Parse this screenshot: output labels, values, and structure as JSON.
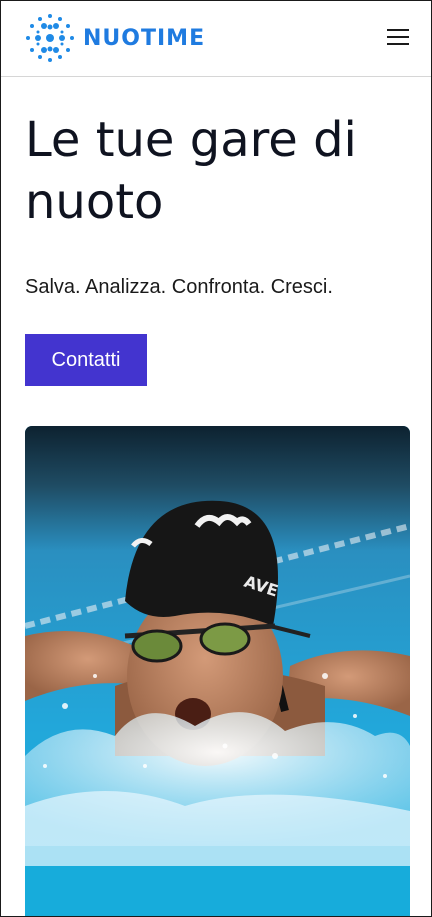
{
  "header": {
    "logo_text": "NUOTIME",
    "logo_icon": "dot-grid-logo-icon",
    "menu_icon": "hamburger-menu-icon",
    "brand_color": "#1f7be0"
  },
  "hero": {
    "title": "Le tue gare di nuoto",
    "subtitle": "Salva. Analizza. Confronta. Cresci.",
    "cta_label": "Contatti",
    "cta_color": "#4334cf"
  },
  "photo": {
    "subject": "swimmer-butterfly-photo",
    "cap_text": "AVE"
  }
}
